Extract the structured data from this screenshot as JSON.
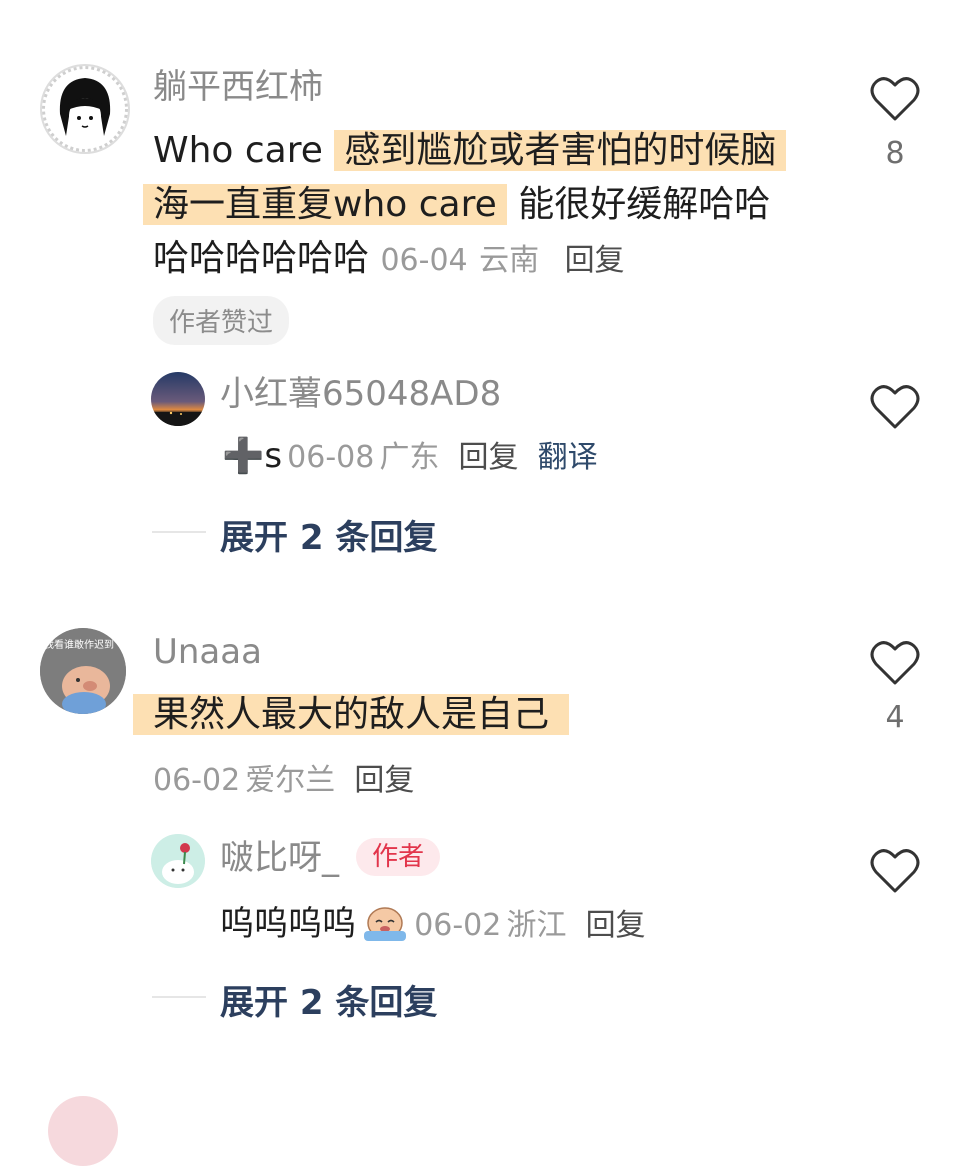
{
  "comments": [
    {
      "username": "躺平西红柿",
      "text_plain_1": "Who care ",
      "text_hl_1": "感到尴尬或者害怕的时候脑",
      "text_hl_2": "海一直重复who care",
      "text_plain_2": " 能很好缓解哈哈",
      "text_line3": "哈哈哈哈哈哈",
      "date": "06-04",
      "location": "云南",
      "reply_label": "回复",
      "badge": "作者赞过",
      "likes": "8",
      "reply": {
        "username": "小红薯65048AD8",
        "text": "➕s",
        "date": "06-08",
        "location": "广东",
        "reply_label": "回复",
        "translate_label": "翻译"
      },
      "expand_label": "展开 2 条回复"
    },
    {
      "username": "Unaaa",
      "avatar_text": "我看谁敢作迟到",
      "text_hl": "果然人最大的敌人是自己",
      "date": "06-02",
      "location": "爱尔兰",
      "reply_label": "回复",
      "likes": "4",
      "reply": {
        "username": "啵比呀_",
        "author_tag": "作者",
        "text": "呜呜呜呜",
        "date": "06-02",
        "location": "浙江",
        "reply_label": "回复"
      },
      "expand_label": "展开 2 条回复"
    }
  ],
  "colors": {
    "highlight": "#fde0b3",
    "username": "#8a8a8a",
    "expand_link": "#2c3f5e",
    "author_tag": "#e2354b"
  }
}
